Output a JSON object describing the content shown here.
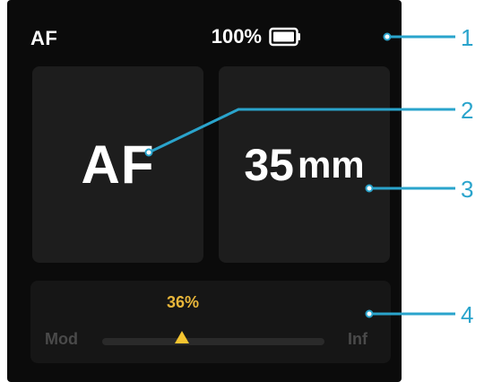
{
  "status": {
    "focus_mode": "AF",
    "battery_percent": "100%",
    "battery_icon": "battery-full-icon"
  },
  "tiles": {
    "focus_mode_value": "AF",
    "focal_length_value": "35",
    "focal_length_unit": "mm"
  },
  "focus_distance": {
    "percent_label": "36%",
    "level": 0.36,
    "min_label": "Mod",
    "max_label": "Inf",
    "marker_color": "#f4c430"
  },
  "callouts": [
    "1",
    "2",
    "3",
    "4"
  ],
  "colors": {
    "screen_bg": "#0b0b0b",
    "tile_bg": "#1d1d1d",
    "accent_yellow": "#e8b63a",
    "callout_blue": "#2aa4cc"
  }
}
